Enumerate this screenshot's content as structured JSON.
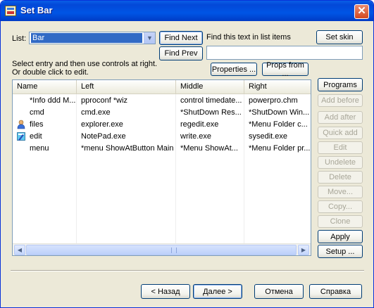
{
  "window": {
    "title": "Set Bar"
  },
  "list": {
    "label": "List:",
    "selected": "Bar",
    "find_next": "Find Next",
    "find_prev": "Find Prev",
    "find_hint": "Find this text in list items",
    "set_skin": "Set skin",
    "instructions_1": "Select entry and then use controls at right.",
    "instructions_2": "Or double click to edit.",
    "properties": "Properties ...",
    "props_from": "Props from ...",
    "search_value": ""
  },
  "table": {
    "columns": [
      "Name",
      "Left",
      "Middle",
      "Right"
    ],
    "rows": [
      {
        "name": "*Info ddd M...",
        "left": "pproconf *wiz",
        "middle": "control timedate...",
        "right": "powerpro.chm",
        "icon": ""
      },
      {
        "name": "cmd",
        "left": "cmd.exe",
        "middle": "*ShutDown Res...",
        "right": "*ShutDown Win...",
        "icon": ""
      },
      {
        "name": "files",
        "left": "explorer.exe",
        "middle": "regedit.exe",
        "right": "*Menu Folder c...",
        "icon": "user-icon"
      },
      {
        "name": "edit",
        "left": "NotePad.exe",
        "middle": "write.exe",
        "right": "sysedit.exe",
        "icon": "notepad-icon"
      },
      {
        "name": "menu",
        "left": "*menu ShowAtButton Main",
        "middle": "*Menu ShowAt...",
        "right": "*Menu Folder pr...",
        "icon": ""
      }
    ]
  },
  "side_buttons": {
    "programs": "Programs",
    "add_before": "Add before",
    "add_after": "Add after",
    "quick_add": "Quick add",
    "edit": "Edit",
    "undelete": "Undelete",
    "delete": "Delete",
    "move": "Move...",
    "copy": "Copy...",
    "clone": "Clone",
    "apply": "Apply",
    "setup": "Setup ..."
  },
  "footer": {
    "back": "< Назад",
    "next": "Далее >",
    "cancel": "Отмена",
    "help": "Справка"
  }
}
